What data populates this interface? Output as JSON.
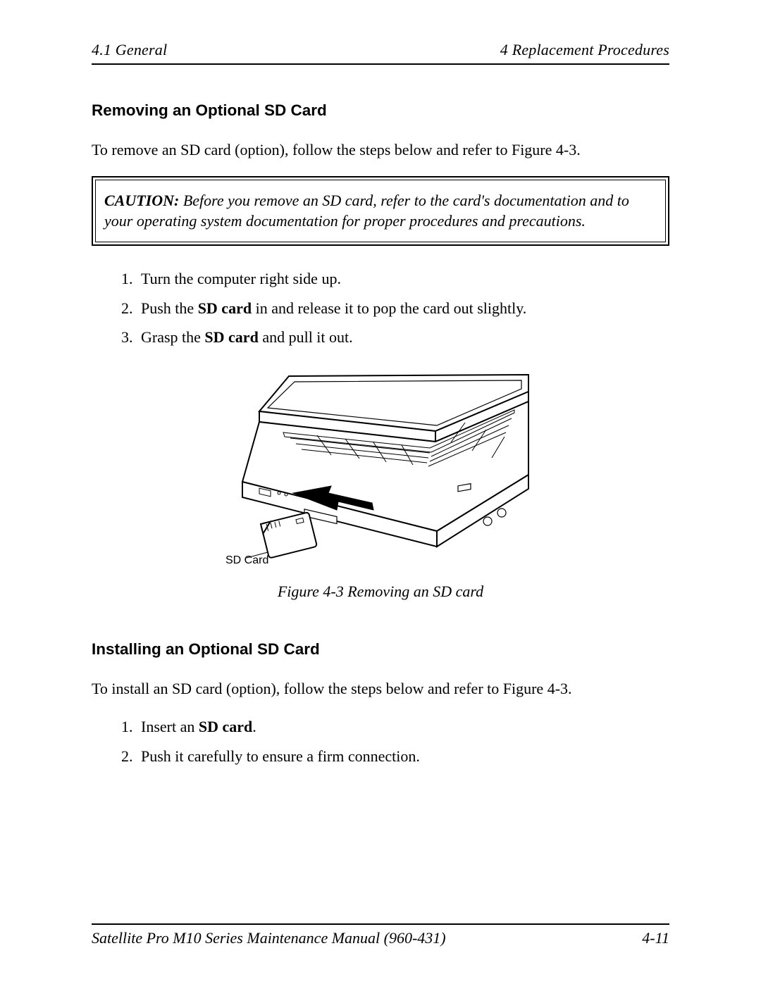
{
  "header": {
    "left": "4.1  General",
    "right": "4  Replacement Procedures"
  },
  "section1": {
    "heading": "Removing an Optional SD Card",
    "intro": "To remove an SD card (option), follow the steps below and refer to Figure 4-3.",
    "caution_label": "CAUTION:",
    "caution_text": "  Before you remove an SD card, refer to the card's documentation and to your operating system documentation for proper procedures and precautions.",
    "steps": {
      "s1": "Turn the computer right side up.",
      "s2_pre": "Push the ",
      "s2_bold": "SD card",
      "s2_post": " in and release it to pop the card out slightly.",
      "s3_pre": "Grasp the ",
      "s3_bold": "SD card",
      "s3_post": " and pull it out."
    }
  },
  "figure": {
    "label": "SD Card",
    "caption": "Figure 4-3   Removing an SD card"
  },
  "section2": {
    "heading": "Installing an Optional SD Card",
    "intro": "To install an SD card (option), follow the steps below and refer to Figure 4-3.",
    "steps": {
      "s1_pre": "Insert an ",
      "s1_bold": "SD card",
      "s1_post": ".",
      "s2": "Push it carefully to ensure a firm connection."
    }
  },
  "footer": {
    "left": "Satellite Pro M10 Series Maintenance Manual (960-431)",
    "right": "4-11"
  }
}
